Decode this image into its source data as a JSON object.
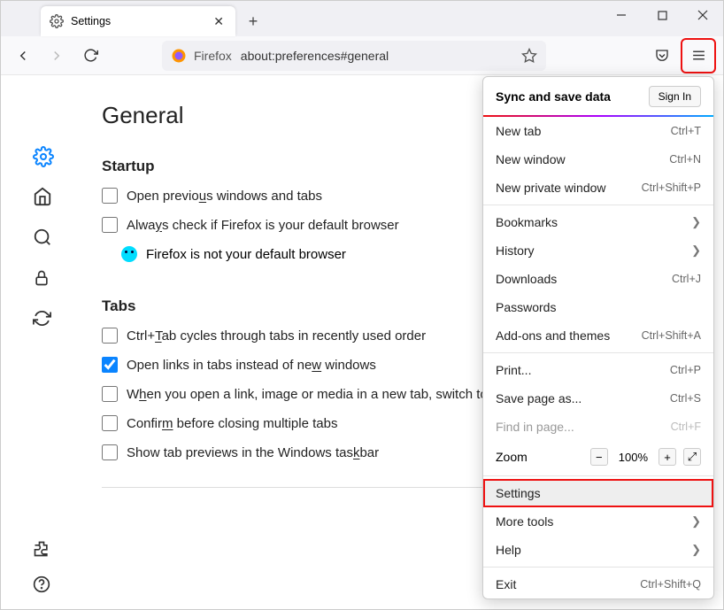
{
  "tab": {
    "title": "Settings"
  },
  "url": {
    "prefix": "Firefox",
    "address": "about:preferences#general"
  },
  "page": {
    "heading": "General",
    "startup": {
      "title": "Startup",
      "open_previous": "Open previous windows and tabs",
      "always_check": "Always check if Firefox is your default browser",
      "not_default": "Firefox is not your default browser"
    },
    "tabs": {
      "title": "Tabs",
      "ctrl_tab": "Ctrl+Tab cycles through tabs in recently used order",
      "open_links": "Open links in tabs instead of new windows",
      "switch_to": "When you open a link, image or media in a new tab, switch to it immediately",
      "confirm_close": "Confirm before closing multiple tabs",
      "taskbar_preview": "Show tab previews in the Windows taskbar"
    }
  },
  "menu": {
    "sync": "Sync and save data",
    "sign_in": "Sign In",
    "new_tab": {
      "label": "New tab",
      "shortcut": "Ctrl+T"
    },
    "new_window": {
      "label": "New window",
      "shortcut": "Ctrl+N"
    },
    "new_private": {
      "label": "New private window",
      "shortcut": "Ctrl+Shift+P"
    },
    "bookmarks": "Bookmarks",
    "history": "History",
    "downloads": {
      "label": "Downloads",
      "shortcut": "Ctrl+J"
    },
    "passwords": "Passwords",
    "addons": {
      "label": "Add-ons and themes",
      "shortcut": "Ctrl+Shift+A"
    },
    "print": {
      "label": "Print...",
      "shortcut": "Ctrl+P"
    },
    "save_as": {
      "label": "Save page as...",
      "shortcut": "Ctrl+S"
    },
    "find": {
      "label": "Find in page...",
      "shortcut": "Ctrl+F"
    },
    "zoom": {
      "label": "Zoom",
      "value": "100%"
    },
    "settings": "Settings",
    "more_tools": "More tools",
    "help": "Help",
    "exit": {
      "label": "Exit",
      "shortcut": "Ctrl+Shift+Q"
    }
  }
}
